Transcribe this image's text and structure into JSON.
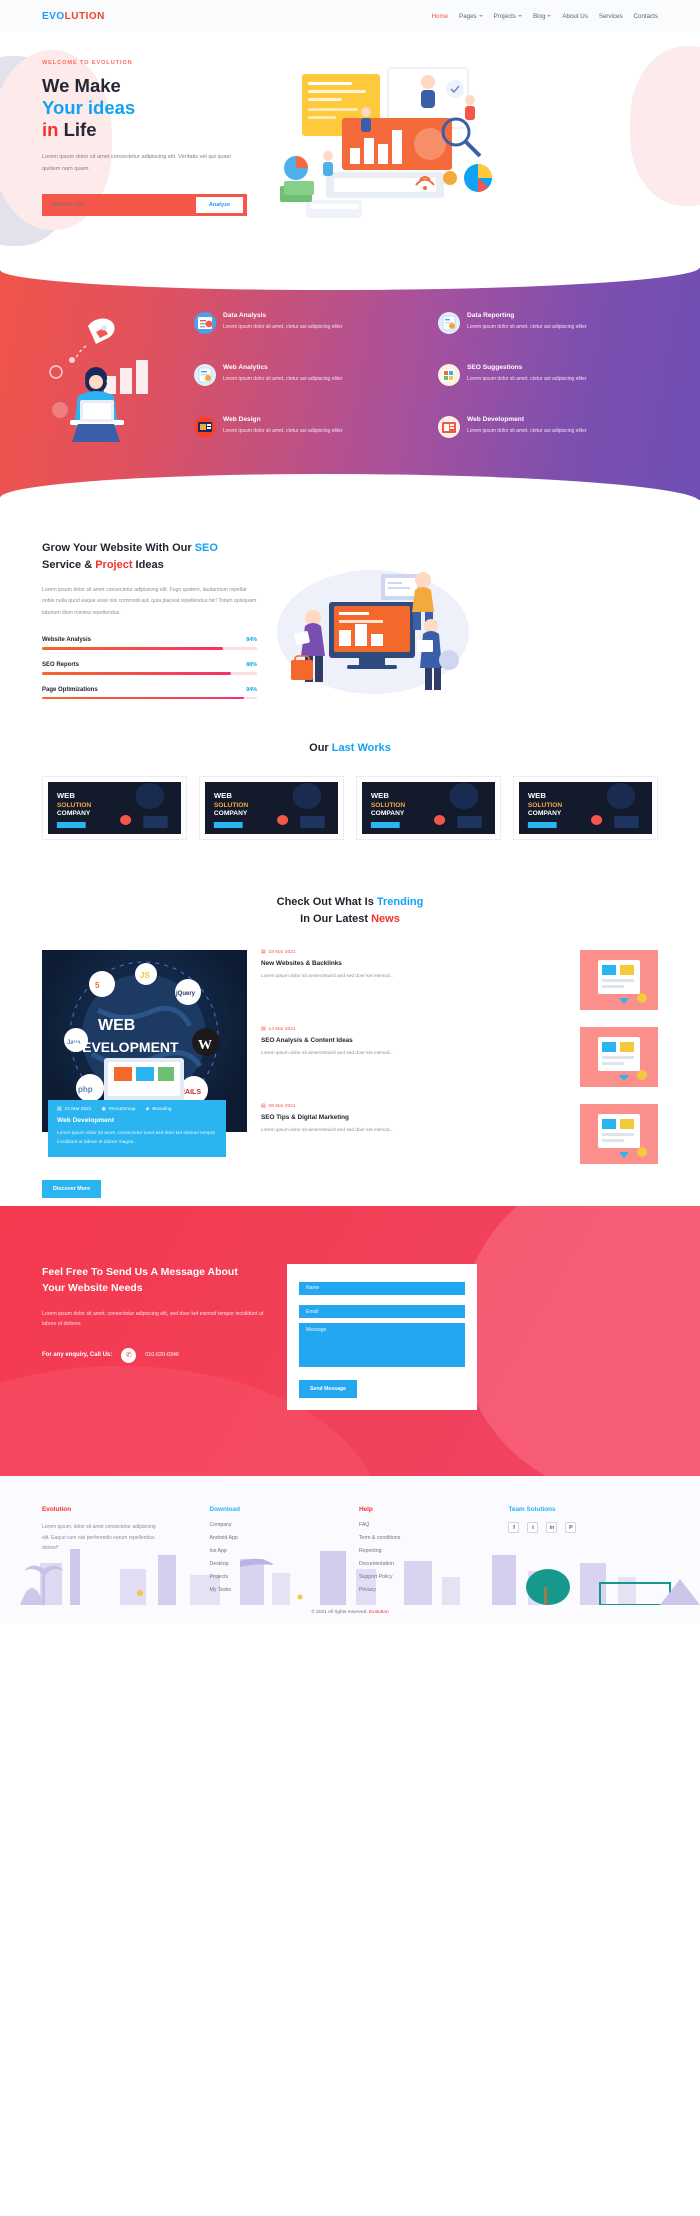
{
  "nav": {
    "logo_ev": "EVO",
    "logo_lution": "LUTION",
    "items": [
      {
        "label": "Home",
        "active": true,
        "caret": false
      },
      {
        "label": "Pages",
        "active": false,
        "caret": true
      },
      {
        "label": "Projects",
        "active": false,
        "caret": true
      },
      {
        "label": "Blog",
        "active": false,
        "caret": true
      },
      {
        "label": "About Us",
        "active": false,
        "caret": false
      },
      {
        "label": "Services",
        "active": false,
        "caret": false
      },
      {
        "label": "Contacts",
        "active": false,
        "caret": false
      }
    ]
  },
  "hero": {
    "eyebrow": "WELCOME TO EVOLUTION",
    "line1": "We Make",
    "line2": "Your ideas",
    "line3a": "in",
    "line3b": "Life",
    "paragraph": "Lorem ipsum dolor sit amet consectetur adipiscing elit. Veritatis vel qui quasi quidem nam quam.",
    "input_placeholder": "Website URL...",
    "input_value": "",
    "button": "Analyze"
  },
  "services": {
    "items": [
      {
        "title": "Data Analysis",
        "desc": "Lorem ipsum dolor sit amet, ctetur aoi adipiscing eliter",
        "color": "#f0f3ff"
      },
      {
        "title": "Data Reporting",
        "desc": "Lorem ipsum dolor sit amet, ctetur aoi adipiscing eliter",
        "color": "#eef6ff"
      },
      {
        "title": "Web Analytics",
        "desc": "Lorem ipsum dolor sit amet, ctetur aoi adipiscing eliter",
        "color": "#eef6ff"
      },
      {
        "title": "SEO Suggestions",
        "desc": "Lorem ipsum dolor sit amet, ctetur aoi adipiscing eliter",
        "color": "#fff1e4"
      },
      {
        "title": "Web Design",
        "desc": "Lorem ipsum dolor sit amet, ctetur aoi adipiscing eliter",
        "color": "#f4402f"
      },
      {
        "title": "Web Development",
        "desc": "Lorem ipsum dolor sit amet, ctetur aoi adipiscing eliter",
        "color": "#fff0e8"
      }
    ]
  },
  "grow": {
    "title_a": "Grow Your Website With Our ",
    "title_seo": "SEO",
    "title_b": "Service & ",
    "title_project": "Project",
    "title_c": " Ideas",
    "paragraph": "Lorem ipsum dolor sit amet consectetur adipisicing elit. Fugo quidem, laudantium repellat nobis nulla quod eaque esse nisi commodi aut, quia placeat repellendus hic! Totam quisquam laborum illum minima repellendus.",
    "bars": [
      {
        "label": "Website Analysis",
        "value": "84%",
        "pct": 84
      },
      {
        "label": "SEO Reports",
        "value": "88%",
        "pct": 88
      },
      {
        "label": "Page Optimizations",
        "value": "94%",
        "pct": 94
      }
    ]
  },
  "works": {
    "title_a": "Our ",
    "title_b": "Last Works",
    "cards": [
      {
        "l1": "WEB",
        "l2": "SOLUTION",
        "l3": "COMPANY"
      },
      {
        "l1": "WEB",
        "l2": "SOLUTION",
        "l3": "COMPANY"
      },
      {
        "l1": "WEB",
        "l2": "SOLUTION",
        "l3": "COMPANY"
      },
      {
        "l1": "WEB",
        "l2": "SOLUTION",
        "l3": "COMPANY"
      }
    ]
  },
  "news": {
    "title_a": "Check Out What Is ",
    "title_trending": "Trending",
    "title_b": "In Our Latest ",
    "title_news": "News",
    "featured": {
      "image_title_1": "WEB",
      "image_title_2": "DEVELOPMENT",
      "date": "24 Mar 2021",
      "author": "#IAcuIGroup",
      "tag": "Branding",
      "title": "Web Development",
      "text": "Lorem ipsum dolor sit amet, consectetur amet sed doer ket eismod tempor incididunt ut labore et dolore magna..."
    },
    "items": [
      {
        "date": "18 Mar 2021",
        "title": "New Websites & Backlinks",
        "text": "Lorem ipsum dolor sit amsectetuird and sed doer ket eismod..."
      },
      {
        "date": "14 Mar 2021",
        "title": "SEO Analysis & Content Ideas",
        "text": "Lorem ipsum dolor sit amsectetuird and sed doer ket eismod..."
      },
      {
        "date": "06 Mar 2021",
        "title": "SEO Tips & Digital Marketing",
        "text": "Lorem ipsum dolor sit amsectetuird and sed doer ket eismod..."
      }
    ],
    "discover_button": "Discover More"
  },
  "contact": {
    "title_l1": "Feel Free To Send Us A Message About",
    "title_l2": "Your Website Needs",
    "paragraph": "Lorem ipsum dolor sit amet, consectetur adipiscing elit, sed doer ket eismod tempor incididunt ut labore et dolores",
    "call_label": "For any enquiry, Call Us:",
    "phone": "010-020-0346",
    "form": {
      "name_placeholder": "Name",
      "email_placeholder": "Email",
      "message_placeholder": "Message",
      "name_value": "",
      "email_value": "",
      "message_value": "",
      "submit": "Send Message"
    }
  },
  "footer": {
    "brand_heading": "Evolution",
    "brand_text": "Lorem ipsum, dolor sit amet consectetur adipisicing elit. Eaque cum nisi perferendis earum repellendus dolore!!",
    "download_heading": "Download",
    "download_links": [
      "Company",
      "Android App",
      "Ios App",
      "Desktop",
      "Projects",
      "My Tasks"
    ],
    "help_heading": "Help",
    "help_links": [
      "FAQ",
      "Term & conditions",
      "Reporting",
      "Documentation",
      "Support Policy",
      "Privacy"
    ],
    "team_heading": "Team Solutions",
    "socials": [
      "facebook-icon",
      "twitter-icon",
      "linkedin-icon",
      "pinterest-icon"
    ],
    "social_glyphs": [
      "f",
      "t",
      "in",
      "P"
    ],
    "copyright_pre": "© 2021 All rights reserved. ",
    "copyright_brand": "Evolution"
  },
  "colors": {
    "brand_blue": "#11a2f3",
    "brand_red": "#f4322c",
    "coral": "#f4564a",
    "gradient_start": "#f0544a",
    "gradient_end": "#6f4fb3"
  }
}
